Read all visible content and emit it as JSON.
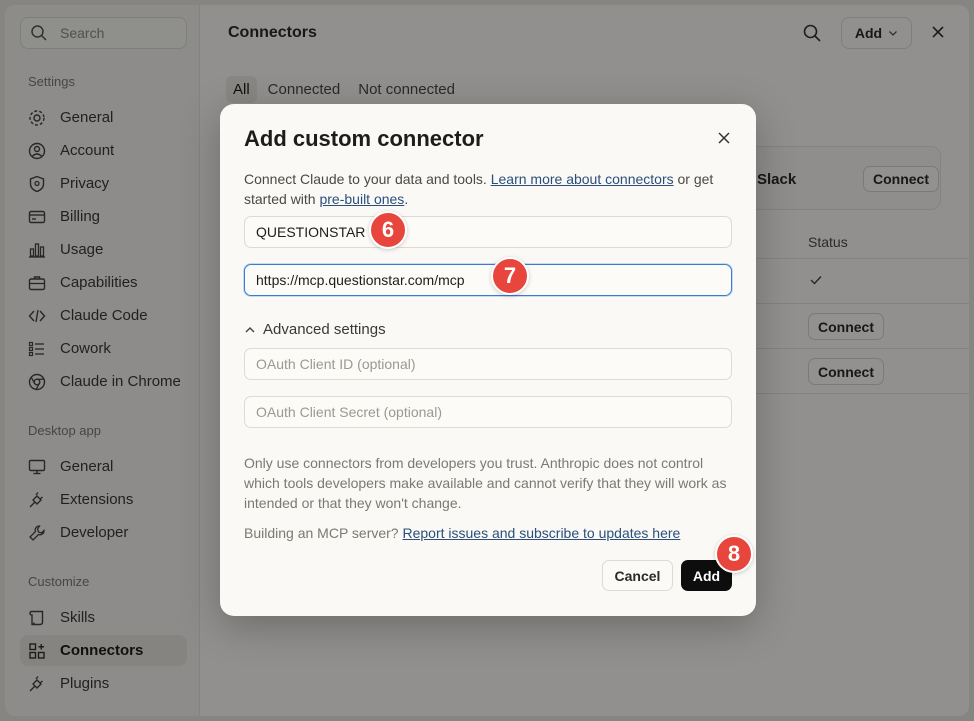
{
  "sidebar": {
    "search_placeholder": "Search",
    "settings_title": "Settings",
    "settings_items": [
      {
        "label": "General",
        "icon": "gear-icon"
      },
      {
        "label": "Account",
        "icon": "user-circle-icon"
      },
      {
        "label": "Privacy",
        "icon": "shield-icon"
      },
      {
        "label": "Billing",
        "icon": "credit-card-icon"
      },
      {
        "label": "Usage",
        "icon": "bar-chart-icon"
      },
      {
        "label": "Capabilities",
        "icon": "briefcase-icon"
      },
      {
        "label": "Claude Code",
        "icon": "code-icon"
      },
      {
        "label": "Cowork",
        "icon": "checklist-icon"
      },
      {
        "label": "Claude in Chrome",
        "icon": "chrome-icon"
      }
    ],
    "desktop_title": "Desktop app",
    "desktop_items": [
      {
        "label": "General",
        "icon": "monitor-icon"
      },
      {
        "label": "Extensions",
        "icon": "plug-icon"
      },
      {
        "label": "Developer",
        "icon": "wrench-icon"
      }
    ],
    "customize_title": "Customize",
    "customize_items": [
      {
        "label": "Skills",
        "icon": "scroll-icon"
      },
      {
        "label": "Connectors",
        "icon": "grid-plus-icon"
      },
      {
        "label": "Plugins",
        "icon": "plug-icon"
      }
    ]
  },
  "main": {
    "title": "Connectors",
    "add_label": "Add",
    "tabs": [
      "All",
      "Connected",
      "Not connected"
    ],
    "card_name": "Slack",
    "connect_label": "Connect",
    "status_header": "Status"
  },
  "modal": {
    "title": "Add custom connector",
    "desc_prefix": "Connect Claude to your data and tools. ",
    "desc_link1": "Learn more about connectors",
    "desc_mid": " or get started with ",
    "desc_link2": "pre-built ones",
    "desc_suffix": ".",
    "name_value": "QUESTIONSTAR",
    "url_value": "https://mcp.questionstar.com/mcp",
    "advanced_label": "Advanced settings",
    "client_id_placeholder": "OAuth Client ID (optional)",
    "client_secret_placeholder": "OAuth Client Secret (optional)",
    "warning": "Only use connectors from developers you trust. Anthropic does not control which tools developers make available and cannot verify that they will work as intended or that they won't change.",
    "building_prefix": "Building an MCP server? ",
    "building_link": "Report issues and subscribe to updates here",
    "cancel_label": "Cancel",
    "add_label": "Add"
  },
  "annotations": {
    "step6": "6",
    "step7": "7",
    "step8": "8",
    "color": "#e8453c"
  }
}
